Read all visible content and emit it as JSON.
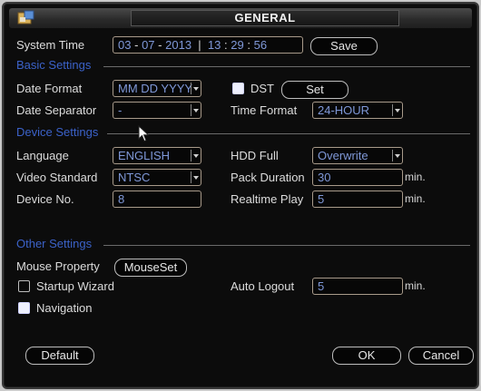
{
  "window": {
    "title": "GENERAL"
  },
  "system_time": {
    "label": "System Time",
    "month": "03",
    "day": "07",
    "year": "2013",
    "hour": "13",
    "minute": "29",
    "second": "56",
    "date_separator_char": "-",
    "time_separator_char": ":",
    "save_label": "Save"
  },
  "basic_settings": {
    "heading": "Basic Settings",
    "date_format_label": "Date Format",
    "date_format_value": "MM DD YYYY",
    "dst_label": "DST",
    "dst_checked": true,
    "dst_set_label": "Set",
    "date_separator_label": "Date Separator",
    "date_separator_value": "-",
    "time_format_label": "Time Format",
    "time_format_value": "24-HOUR"
  },
  "device_settings": {
    "heading": "Device Settings",
    "language_label": "Language",
    "language_value": "ENGLISH",
    "hdd_full_label": "HDD Full",
    "hdd_full_value": "Overwrite",
    "video_standard_label": "Video Standard",
    "video_standard_value": "NTSC",
    "pack_duration_label": "Pack Duration",
    "pack_duration_value": "30",
    "pack_duration_unit": "min.",
    "device_no_label": "Device No.",
    "device_no_value": "8",
    "realtime_play_label": "Realtime Play",
    "realtime_play_value": "5",
    "realtime_play_unit": "min."
  },
  "other_settings": {
    "heading": "Other Settings",
    "mouse_property_label": "Mouse Property",
    "mouse_set_label": "MouseSet",
    "startup_wizard_label": "Startup Wizard",
    "startup_wizard_checked": false,
    "auto_logout_label": "Auto Logout",
    "auto_logout_value": "5",
    "auto_logout_unit": "min.",
    "navigation_label": "Navigation",
    "navigation_checked": true
  },
  "footer": {
    "default_label": "Default",
    "ok_label": "OK",
    "cancel_label": "Cancel"
  },
  "colors": {
    "section_heading": "#3b62c9",
    "field_value": "#7f98d8",
    "background": "#0c0c0c"
  },
  "icons": {
    "logo": "app-logo-icon",
    "cursor": "mouse-pointer-icon"
  }
}
